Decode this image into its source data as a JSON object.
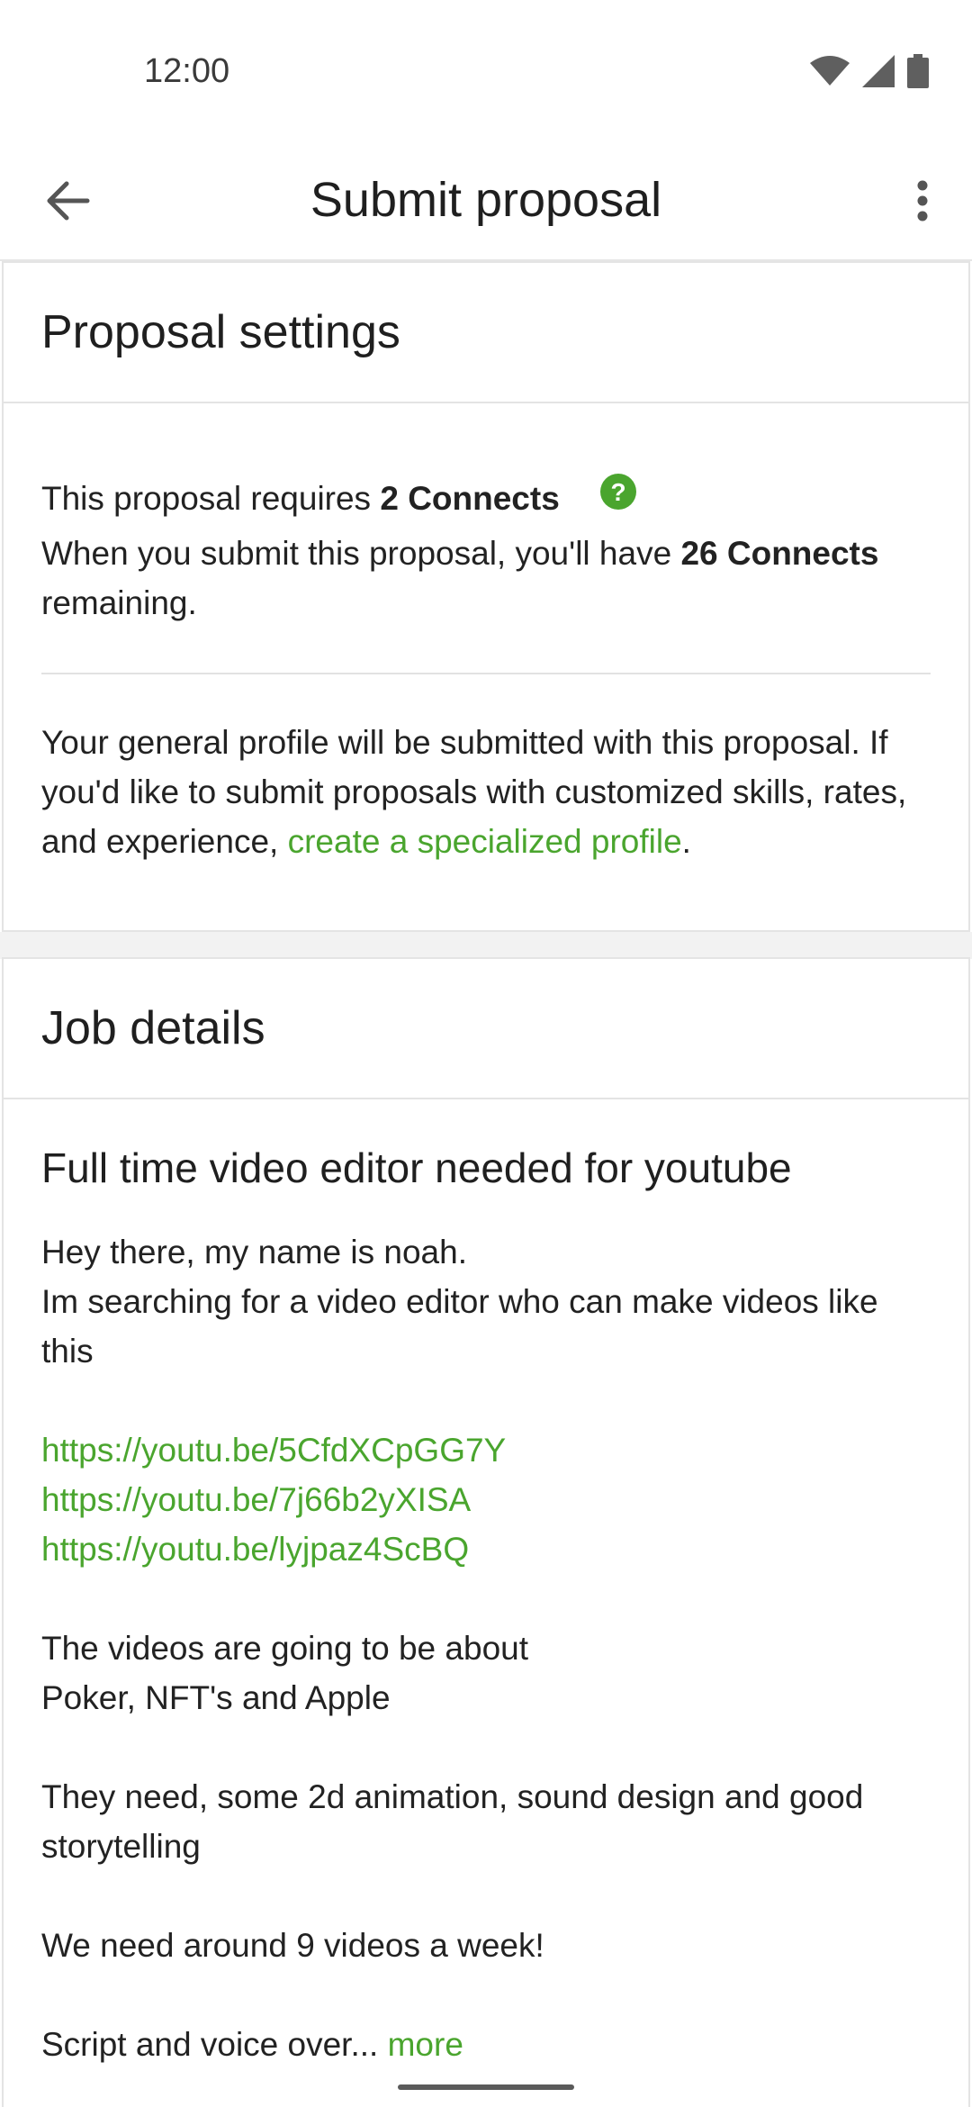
{
  "status_bar": {
    "time": "12:00",
    "icons": [
      "wifi-icon",
      "signal-icon",
      "battery-icon"
    ]
  },
  "app_bar": {
    "title": "Submit proposal",
    "back_icon": "arrow-back-icon",
    "more_icon": "more-vert-icon"
  },
  "proposal_settings": {
    "header": "Proposal settings",
    "requires_prefix": "This proposal requires ",
    "requires_connects": "2 Connects",
    "remaining_prefix": "When you submit this proposal, you'll have ",
    "remaining_connects": "26 Connects",
    "remaining_suffix": "remaining.",
    "profile_text": "Your general profile will be submitted with this proposal. If you'd like to submit proposals with customized skills, rates, and experience, ",
    "profile_link": "create a specialized profile",
    "profile_period": "."
  },
  "job_details": {
    "header": "Job details",
    "title": "Full time video editor needed for youtube",
    "intro_line1": "Hey there, my name is noah.",
    "intro_line2": "Im searching for a video editor who can make videos like this",
    "links": [
      "https://youtu.be/5CfdXCpGG7Y",
      "https://youtu.be/7j66b2yXISA",
      "https://youtu.be/lyjpaz4ScBQ"
    ],
    "topics_line1": "The videos are going to be about",
    "topics_line2": "Poker, NFT's and Apple",
    "needs": "They need, some 2d animation, sound design and good storytelling",
    "volume": "We need around 9 videos a week!",
    "truncated": "Script and voice over... ",
    "more_link": "more"
  },
  "colors": {
    "accent_green": "#4aa52e",
    "divider": "#e4e4e4",
    "section_gap": "#f2f2f2"
  }
}
